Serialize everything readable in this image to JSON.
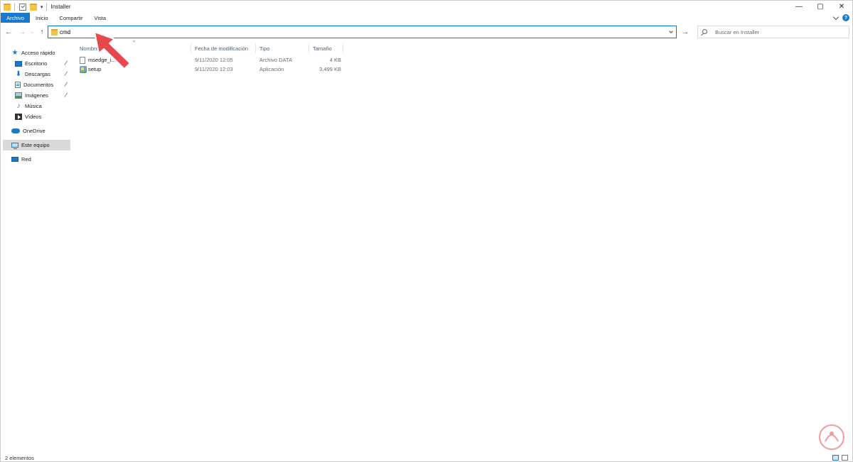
{
  "window": {
    "title": "Installer",
    "controls": {
      "minimize": "—",
      "maximize": "▢",
      "close": "✕"
    }
  },
  "ribbon": {
    "tabs": [
      "Archivo",
      "Inicio",
      "Compartir",
      "Vista"
    ],
    "help_label": "?"
  },
  "address": {
    "value": "cmd",
    "go_icon": "right-arrow-icon"
  },
  "search": {
    "placeholder": "Buscar en Installer"
  },
  "nav": {
    "quick_access": "Acceso rápido",
    "items": [
      {
        "label": "Escritorio",
        "pinned": true,
        "icon": "desktop-icon"
      },
      {
        "label": "Descargas",
        "pinned": true,
        "icon": "download-icon"
      },
      {
        "label": "Documentos",
        "pinned": true,
        "icon": "documents-icon"
      },
      {
        "label": "Imágenes",
        "pinned": true,
        "icon": "pictures-icon"
      },
      {
        "label": "Música",
        "pinned": false,
        "icon": "music-icon"
      },
      {
        "label": "Vídeos",
        "pinned": false,
        "icon": "videos-icon"
      }
    ],
    "onedrive": "OneDrive",
    "this_pc": "Este equipo",
    "network": "Red"
  },
  "columns": {
    "name": "Nombre",
    "date": "Fecha de modificación",
    "type": "Tipo",
    "size": "Tamaño"
  },
  "files": [
    {
      "name": "msedge_i...",
      "date": "9/11/2020 12:05",
      "type": "Archivo DATA",
      "size": "4 KB",
      "icon": "file-icon"
    },
    {
      "name": "setup",
      "date": "9/11/2020 12:03",
      "type": "Aplicación",
      "size": "3,499 KB",
      "icon": "setup-icon"
    }
  ],
  "status": {
    "count_text": "2 elementos"
  },
  "colors": {
    "accent": "#1979ca",
    "address_border": "#0078d7",
    "selected_nav": "#d9d9d9",
    "pointer_arrow": "#e8474c"
  }
}
